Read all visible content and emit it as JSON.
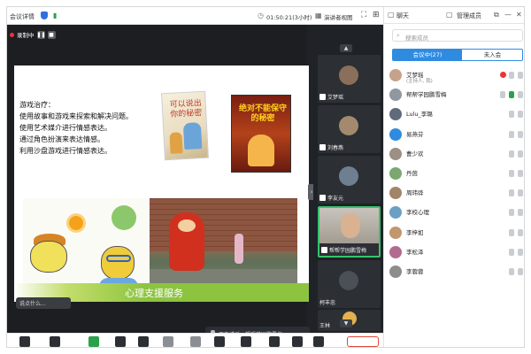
{
  "topbar": {
    "title": "会议详情",
    "timer": "01:50:21(3小时)",
    "view_label": "演讲者视图"
  },
  "recording": {
    "label": "录制中",
    "pause": "❚❚",
    "stop": "■"
  },
  "slide": {
    "lines": [
      "游戏治疗：",
      "使用故事和游戏来探索和解决问题。",
      "使用艺术媒介进行情感表达。",
      "通过角色扮演来表达情感。",
      "利用沙盘游戏进行情感表达。"
    ],
    "book1_title": "可以说出你的秘密",
    "book2_title": "绝对不能保守的秘密",
    "banner": "心理支援服务"
  },
  "chat_pill": "说点什么...",
  "speaking": {
    "label": "正在讲话:",
    "name": "帮帮学园鹏雪梅"
  },
  "video_tiles": [
    {
      "name": "艾梦瑶",
      "kind": "avatar"
    },
    {
      "name": "刘春燕",
      "kind": "avatar"
    },
    {
      "name": "李友元",
      "kind": "avatar"
    },
    {
      "name": "帮帮学园鹏雪梅",
      "kind": "webcam",
      "active": true
    },
    {
      "name": "柯丰忠",
      "kind": "avatar"
    },
    {
      "name": "王林",
      "kind": "avatar"
    }
  ],
  "panel": {
    "chat_tab": "聊天",
    "members_tab": "管理成员",
    "search_placeholder": "搜索成员",
    "in_meeting": "会议中(27)",
    "not_joined": "未入会",
    "members": [
      {
        "name": "艾梦瑶",
        "sub": "(主持人, 我)"
      },
      {
        "name": "帮帮学园鹏雪梅",
        "sub": ""
      },
      {
        "name": "Lulu_李璐",
        "sub": ""
      },
      {
        "name": "易燕芬",
        "sub": ""
      },
      {
        "name": "曹少欢",
        "sub": ""
      },
      {
        "name": "丹茵",
        "sub": ""
      },
      {
        "name": "周玮骅",
        "sub": ""
      },
      {
        "name": "李校心理",
        "sub": ""
      },
      {
        "name": "李梓如",
        "sub": ""
      },
      {
        "name": "李松泽",
        "sub": ""
      },
      {
        "name": "李蓉蓉",
        "sub": ""
      }
    ]
  },
  "colors": {
    "accent": "#2f8be0",
    "recording": "#e33333",
    "speaking_border": "#36c36e",
    "banner_green": "#8cc43f"
  }
}
